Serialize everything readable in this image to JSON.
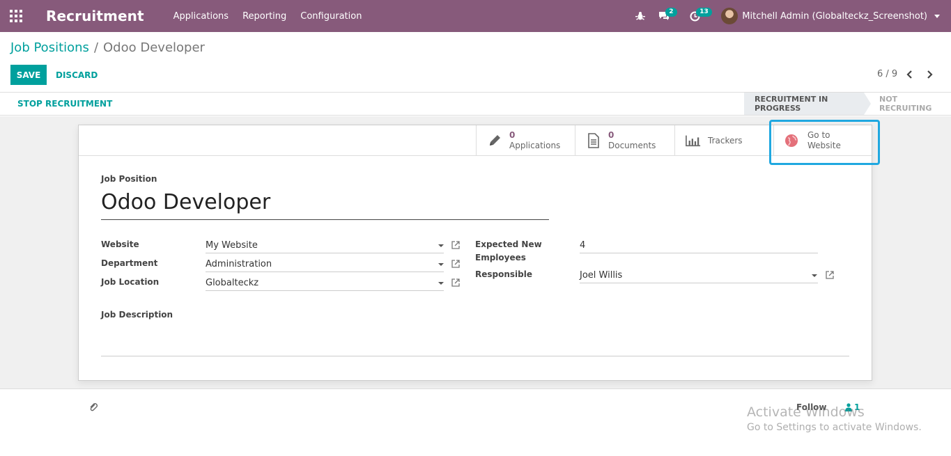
{
  "navbar": {
    "app_title": "Recruitment",
    "menu": [
      "Applications",
      "Reporting",
      "Configuration"
    ],
    "messages_count": "2",
    "activities_count": "13",
    "user_name": "Mitchell Admin (Globalteckz_Screenshot)",
    "bg_color": "#875a7b"
  },
  "breadcrumb": {
    "parent": "Job Positions",
    "separator": "/",
    "current": "Odoo Developer"
  },
  "buttons": {
    "save": "SAVE",
    "discard": "DISCARD"
  },
  "pager": {
    "value": "6 / 9"
  },
  "statusbar": {
    "action": "STOP RECRUITMENT",
    "stages": [
      "RECRUITMENT IN PROGRESS",
      "NOT RECRUITING"
    ],
    "active_stage": "RECRUITMENT IN PROGRESS"
  },
  "smart_buttons": {
    "applications": {
      "count": "0",
      "label": "Applications"
    },
    "documents": {
      "count": "0",
      "label": "Documents"
    },
    "trackers": {
      "label": "Trackers"
    },
    "website": {
      "line1": "Go to",
      "line2": "Website"
    }
  },
  "form": {
    "job_position_label": "Job Position",
    "job_position_value": "Odoo Developer",
    "website_label": "Website",
    "website_value": "My Website",
    "department_label": "Department",
    "department_value": "Administration",
    "job_location_label": "Job Location",
    "job_location_value": "Globalteckz",
    "expected_label_1": "Expected New",
    "expected_label_2": "Employees",
    "expected_value": "4",
    "responsible_label": "Responsible",
    "responsible_value": "Joel Willis",
    "job_description_label": "Job Description"
  },
  "chatter": {
    "follow": "Follow",
    "followers_count": "1"
  },
  "watermark": {
    "line1": "Activate Windows",
    "line2": "Go to Settings to activate Windows."
  },
  "colors": {
    "accent": "#00a09d",
    "primary": "#875a7b",
    "highlight": "#20a8e0"
  }
}
